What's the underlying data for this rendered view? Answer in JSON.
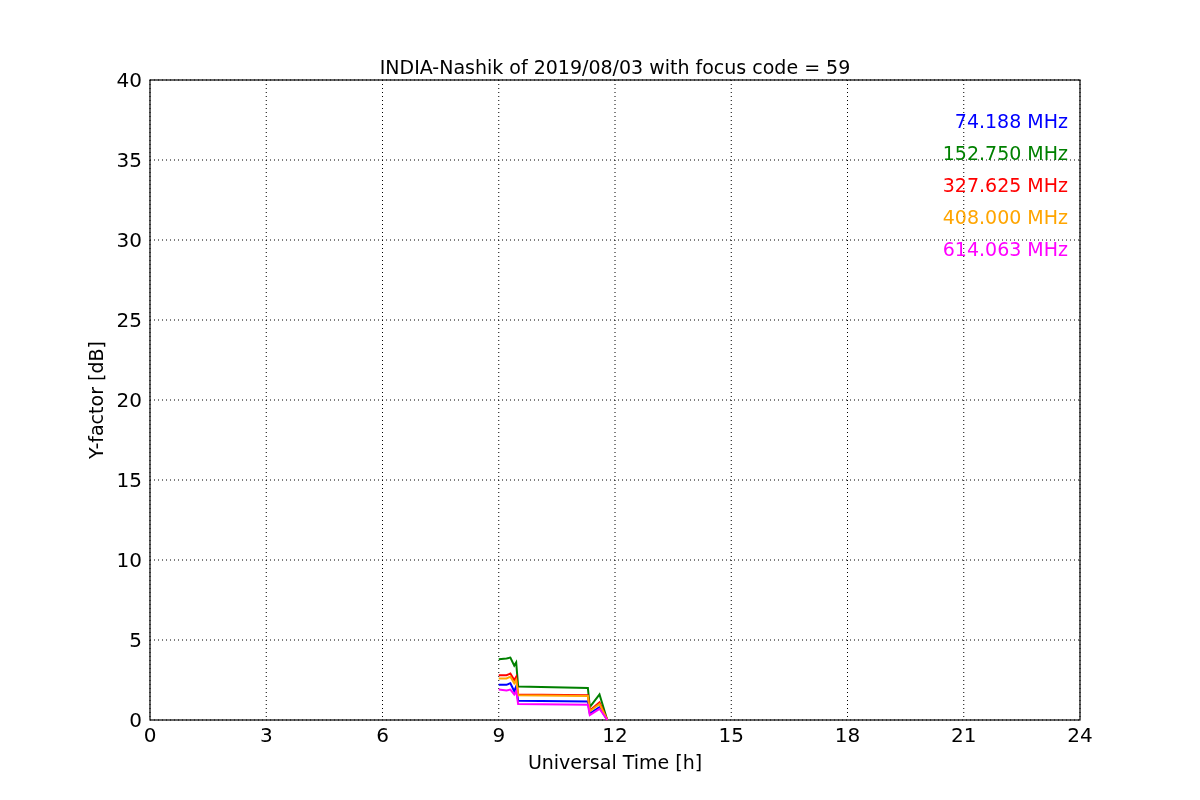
{
  "chart_data": {
    "type": "line",
    "title": "INDIA-Nashik of 2019/08/03 with focus code = 59",
    "xlabel": "Universal Time [h]",
    "ylabel": "Y-factor [dB]",
    "x": [
      9.0,
      9.2,
      9.3,
      9.4,
      9.45,
      9.5,
      11.3,
      11.35,
      11.6,
      11.8
    ],
    "grid": true,
    "xlim": [
      0,
      24
    ],
    "ylim": [
      0,
      40
    ],
    "xticks": [
      0,
      3,
      6,
      9,
      12,
      15,
      18,
      21,
      24
    ],
    "yticks": [
      0,
      5,
      10,
      15,
      20,
      25,
      30,
      35,
      40
    ],
    "series": [
      {
        "name": "74.188 MHz",
        "color": "#0000ff",
        "values": [
          2.2,
          2.2,
          2.3,
          1.8,
          2.1,
          1.2,
          1.15,
          0.4,
          0.8,
          0
        ]
      },
      {
        "name": "152.750 MHz",
        "color": "#008000",
        "values": [
          3.8,
          3.85,
          3.9,
          3.4,
          3.6,
          2.1,
          2.0,
          0.8,
          1.6,
          0
        ]
      },
      {
        "name": "327.625 MHz",
        "color": "#ff0000",
        "values": [
          2.8,
          2.8,
          2.9,
          2.5,
          2.7,
          1.6,
          1.55,
          0.6,
          1.1,
          0
        ]
      },
      {
        "name": "408.000 MHz",
        "color": "#ffa500",
        "values": [
          2.6,
          2.6,
          2.7,
          2.3,
          2.5,
          1.55,
          1.5,
          0.55,
          1.0,
          0
        ]
      },
      {
        "name": "614.063 MHz",
        "color": "#ff00ff",
        "values": [
          1.9,
          1.85,
          1.9,
          1.6,
          1.8,
          1.0,
          0.95,
          0.3,
          0.7,
          0
        ]
      }
    ]
  }
}
